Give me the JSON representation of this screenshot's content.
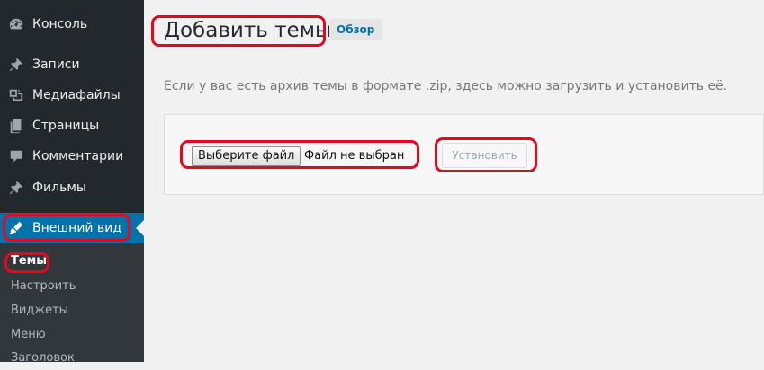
{
  "sidebar": {
    "items": [
      {
        "label": "Консоль",
        "icon": "dashboard-icon"
      },
      {
        "label": "Записи",
        "icon": "pin-icon"
      },
      {
        "label": "Медиафайлы",
        "icon": "media-icon"
      },
      {
        "label": "Страницы",
        "icon": "pages-icon"
      },
      {
        "label": "Комментарии",
        "icon": "comment-icon"
      },
      {
        "label": "Фильмы",
        "icon": "pin-icon"
      },
      {
        "label": "Внешний вид",
        "icon": "appearance-brush-icon"
      }
    ],
    "submenu": [
      "Темы",
      "Настроить",
      "Виджеты",
      "Меню",
      "Заголовок"
    ]
  },
  "main": {
    "title": "Добавить темы",
    "browse_label": "Обзор",
    "help_text": "Если у вас есть архив темы в формате .zip, здесь можно загрузить и установить её.",
    "file_button": "Выберите файл",
    "file_status": "Файл не выбран",
    "install_button": "Установить"
  },
  "colors": {
    "sidebar_bg": "#23282d",
    "active_bg": "#0073aa",
    "annotation_red": "#e8061e",
    "link_blue": "#0073aa"
  }
}
